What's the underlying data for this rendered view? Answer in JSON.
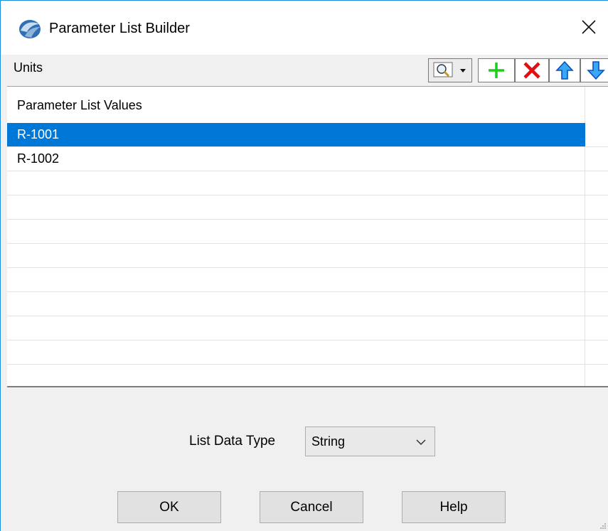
{
  "window": {
    "title": "Parameter List Builder",
    "icon": "app-logo-icon",
    "close_icon": "close-icon"
  },
  "toolbar": {
    "label": "Units",
    "tools": [
      {
        "name": "search-dropdown-button",
        "icon": "magnifier-icon"
      },
      {
        "name": "add-button",
        "icon": "plus-icon",
        "color": "#1ecb1e"
      },
      {
        "name": "delete-button",
        "icon": "x-icon",
        "color": "#e01010"
      },
      {
        "name": "move-up-button",
        "icon": "arrow-up-icon",
        "color": "#1e7be6"
      },
      {
        "name": "move-down-button",
        "icon": "arrow-down-icon",
        "color": "#1e7be6"
      }
    ]
  },
  "list": {
    "header": "Parameter List Values",
    "items": [
      {
        "value": "R-1001",
        "selected": true
      },
      {
        "value": "R-1002",
        "selected": false
      }
    ],
    "selection_color": "#0078d7"
  },
  "data_type": {
    "label": "List Data Type",
    "selected": "String"
  },
  "buttons": {
    "ok": "OK",
    "cancel": "Cancel",
    "help": "Help"
  }
}
